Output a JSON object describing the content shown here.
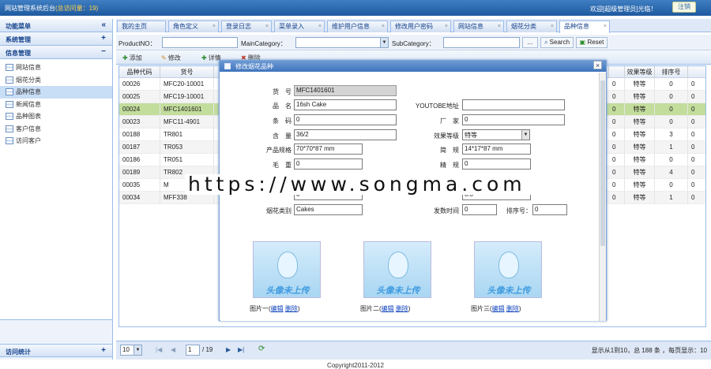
{
  "header": {
    "title": "网站管理系统后台",
    "visits": "(总访问量：19)",
    "welcome": "欢迎[超级管理员]光临！",
    "logout": "注销"
  },
  "sidebar": {
    "menu_title": "功能菜单",
    "collapse": "«",
    "sections": [
      {
        "label": "系统管理",
        "toggle": "+"
      },
      {
        "label": "信息管理",
        "toggle": "−"
      }
    ],
    "items": [
      "网站信息",
      "烟花分类",
      "品种信息",
      "新闻信息",
      "品种图表",
      "客户信息",
      "访问客户"
    ],
    "bottom": {
      "label": "访问统计",
      "toggle": "+"
    }
  },
  "tabs": [
    {
      "label": "我的主页"
    },
    {
      "label": "角色定义"
    },
    {
      "label": "登录日志"
    },
    {
      "label": "菜单录入"
    },
    {
      "label": "维护用户信息"
    },
    {
      "label": "修改用户密码"
    },
    {
      "label": "网站信息"
    },
    {
      "label": "烟花分类"
    },
    {
      "label": "品种信息"
    }
  ],
  "search": {
    "product_label": "ProductNO：",
    "main_label": "MainCategory：",
    "sub_label": "SubCategory：",
    "more": "...",
    "search_btn": "Search",
    "reset_btn": "Reset"
  },
  "toolbar": {
    "add": "添加",
    "edit": "修改",
    "detail": "详情",
    "delete": "删除"
  },
  "grid": {
    "headers": [
      "品种代码",
      "货号",
      "效果等级",
      "排序号"
    ],
    "rows": [
      {
        "code": "00026",
        "no": "MFC20-10001",
        "c": "0",
        "level": "特等",
        "sort": "0",
        "d": "0"
      },
      {
        "code": "00025",
        "no": "MFC19-10001",
        "c": "0",
        "level": "特等",
        "sort": "0",
        "d": "0"
      },
      {
        "code": "00024",
        "no": "MFC1401601",
        "c": "0",
        "level": "特等",
        "sort": "0",
        "d": "0"
      },
      {
        "code": "00023",
        "no": "MFC11-4901",
        "c": "0",
        "level": "特等",
        "sort": "0",
        "d": "0"
      },
      {
        "code": "00188",
        "no": "TR801",
        "c": "0",
        "level": "特等",
        "sort": "3",
        "d": "0"
      },
      {
        "code": "00187",
        "no": "TR053",
        "c": "0",
        "level": "特等",
        "sort": "1",
        "d": "0"
      },
      {
        "code": "00186",
        "no": "TR051",
        "c": "0",
        "level": "特等",
        "sort": "0",
        "d": "0"
      },
      {
        "code": "00189",
        "no": "TR802",
        "c": "0",
        "level": "特等",
        "sort": "4",
        "d": "0"
      },
      {
        "code": "00035",
        "no": "M",
        "c": "0",
        "level": "特等",
        "sort": "0",
        "d": "0"
      },
      {
        "code": "00034",
        "no": "MFF338",
        "c": "0",
        "level": "特等",
        "sort": "1",
        "d": "0"
      }
    ]
  },
  "pager": {
    "page_size": "10",
    "page": "1",
    "total_pages": "/ 19",
    "summary": "显示从1到10，总 188 条 ，每页显示：10"
  },
  "footer": "Copyright2011-2012",
  "dialog": {
    "title": "修改烟花品种",
    "close": "×",
    "fields": {
      "item_no_label": "货　号",
      "item_no": "MFC1401601",
      "name_label": "品　名",
      "name": "16sh Cake",
      "youtube_label": "YOUTOBE地址",
      "youtube": "",
      "barcode_label": "条　码",
      "barcode": "0",
      "factory_label": "厂　家",
      "factory": "0",
      "content_label": "含　量",
      "content": "36/2",
      "level_label": "效果等级",
      "level": "特等",
      "spec_label": "产品规格",
      "spec": "70*70*87 mm",
      "size_label": "简　规",
      "size": "14*17*87 mm",
      "gross_label": "毛　重",
      "gross": "0",
      "net_label": "精　规",
      "net": "0",
      "hidden1": "0",
      "hidden2": "0.0",
      "category_label": "烟花类别",
      "category": "Cakes",
      "time_label": "发数时间",
      "time": "0",
      "sort_label": "排序号：",
      "sort": "0"
    },
    "photos": [
      {
        "label": "图片一(",
        "edit": "编辑",
        "del": "删除",
        "end": ")",
        "caption": "头像未上传"
      },
      {
        "label": "图片二(",
        "edit": "编辑",
        "del": "删除",
        "end": ")",
        "caption": "头像未上传"
      },
      {
        "label": "图片三(",
        "edit": "编辑",
        "del": "删除",
        "end": ")",
        "caption": "头像未上传"
      }
    ]
  },
  "watermark": "https://www.songma.com"
}
